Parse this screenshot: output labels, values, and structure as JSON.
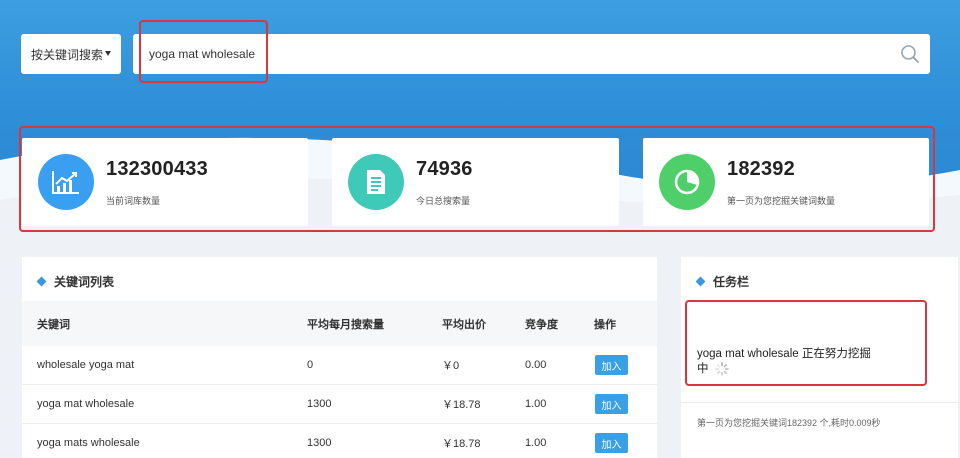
{
  "search": {
    "mode_label": "按关键词搜索",
    "query": "yoga mat wholesale"
  },
  "stats": [
    {
      "value": "132300433",
      "label": "当前词库数量",
      "icon": "chart-trend-icon",
      "color": "#3a9ff0"
    },
    {
      "value": "74936",
      "label": "今日总搜索量",
      "icon": "document-icon",
      "color": "#3fc9b8"
    },
    {
      "value": "182392",
      "label": "第一页为您挖掘关键词数量",
      "icon": "pie-chart-icon",
      "color": "#4fcf6a"
    }
  ],
  "keyword_panel": {
    "title": "关键词列表",
    "columns": [
      "关键词",
      "平均每月搜索量",
      "平均出价",
      "竞争度",
      "操作"
    ],
    "rows": [
      {
        "keyword": "wholesale yoga mat",
        "monthly": "0",
        "bid": "￥0",
        "competition": "0.00",
        "action": "加入"
      },
      {
        "keyword": "yoga mat wholesale",
        "monthly": "1300",
        "bid": "￥18.78",
        "competition": "1.00",
        "action": "加入"
      },
      {
        "keyword": "yoga mats wholesale",
        "monthly": "1300",
        "bid": "￥18.78",
        "competition": "1.00",
        "action": "加入"
      }
    ]
  },
  "task_panel": {
    "title": "任务栏",
    "status_line1": "yoga mat wholesale 正在努力挖掘",
    "status_line2": "中",
    "summary": "第一页为您挖掘关键词182392 个,耗时0.009秒"
  },
  "colors": {
    "accent": "#39a0e6",
    "highlight": "#d9363e"
  }
}
